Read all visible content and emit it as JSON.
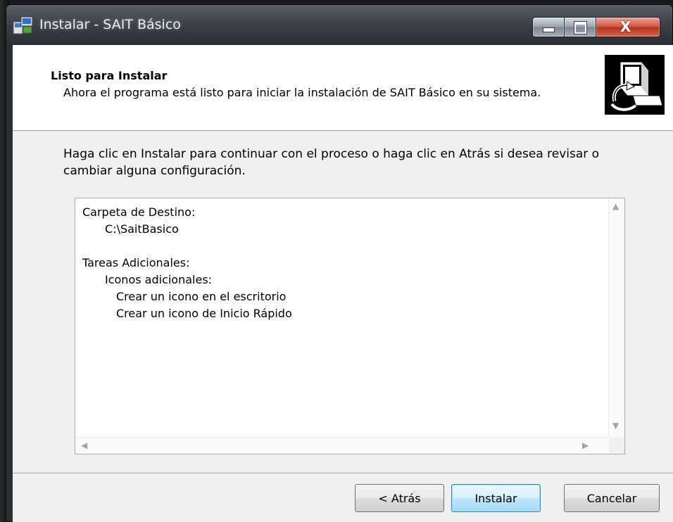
{
  "window": {
    "title": "Instalar - SAIT Básico",
    "controls": {
      "minimize_icon": "minimize-icon",
      "maximize_icon": "maximize-icon",
      "close_icon": "close-icon",
      "close_glyph": "X"
    }
  },
  "header": {
    "title": "Listo para Instalar",
    "subtitle": "Ahora el programa está listo para iniciar la instalación de SAIT Básico en su sistema.",
    "logo_icon": "setup-computer-icon"
  },
  "body": {
    "instructions": "Haga clic en Instalar para continuar con el proceso o haga clic en Atrás si desea revisar o cambiar alguna configuración."
  },
  "summary": {
    "lines": [
      "Carpeta de Destino:",
      "C:\\SaitBasico",
      "",
      "Tareas Adicionales:",
      "Iconos adicionales:",
      "Crear un icono en el escritorio",
      "Crear un icono de Inicio Rápido"
    ],
    "scroll_up": "▲",
    "scroll_down": "▼",
    "scroll_left": "◀",
    "scroll_right": "▶"
  },
  "buttons": {
    "back": "< Atrás",
    "install": "Instalar",
    "cancel": "Cancelar"
  },
  "colors": {
    "accent_default_button": "#3c7fb1",
    "close_button": "#c64b32",
    "dialog_background": "#f0f0f0"
  }
}
